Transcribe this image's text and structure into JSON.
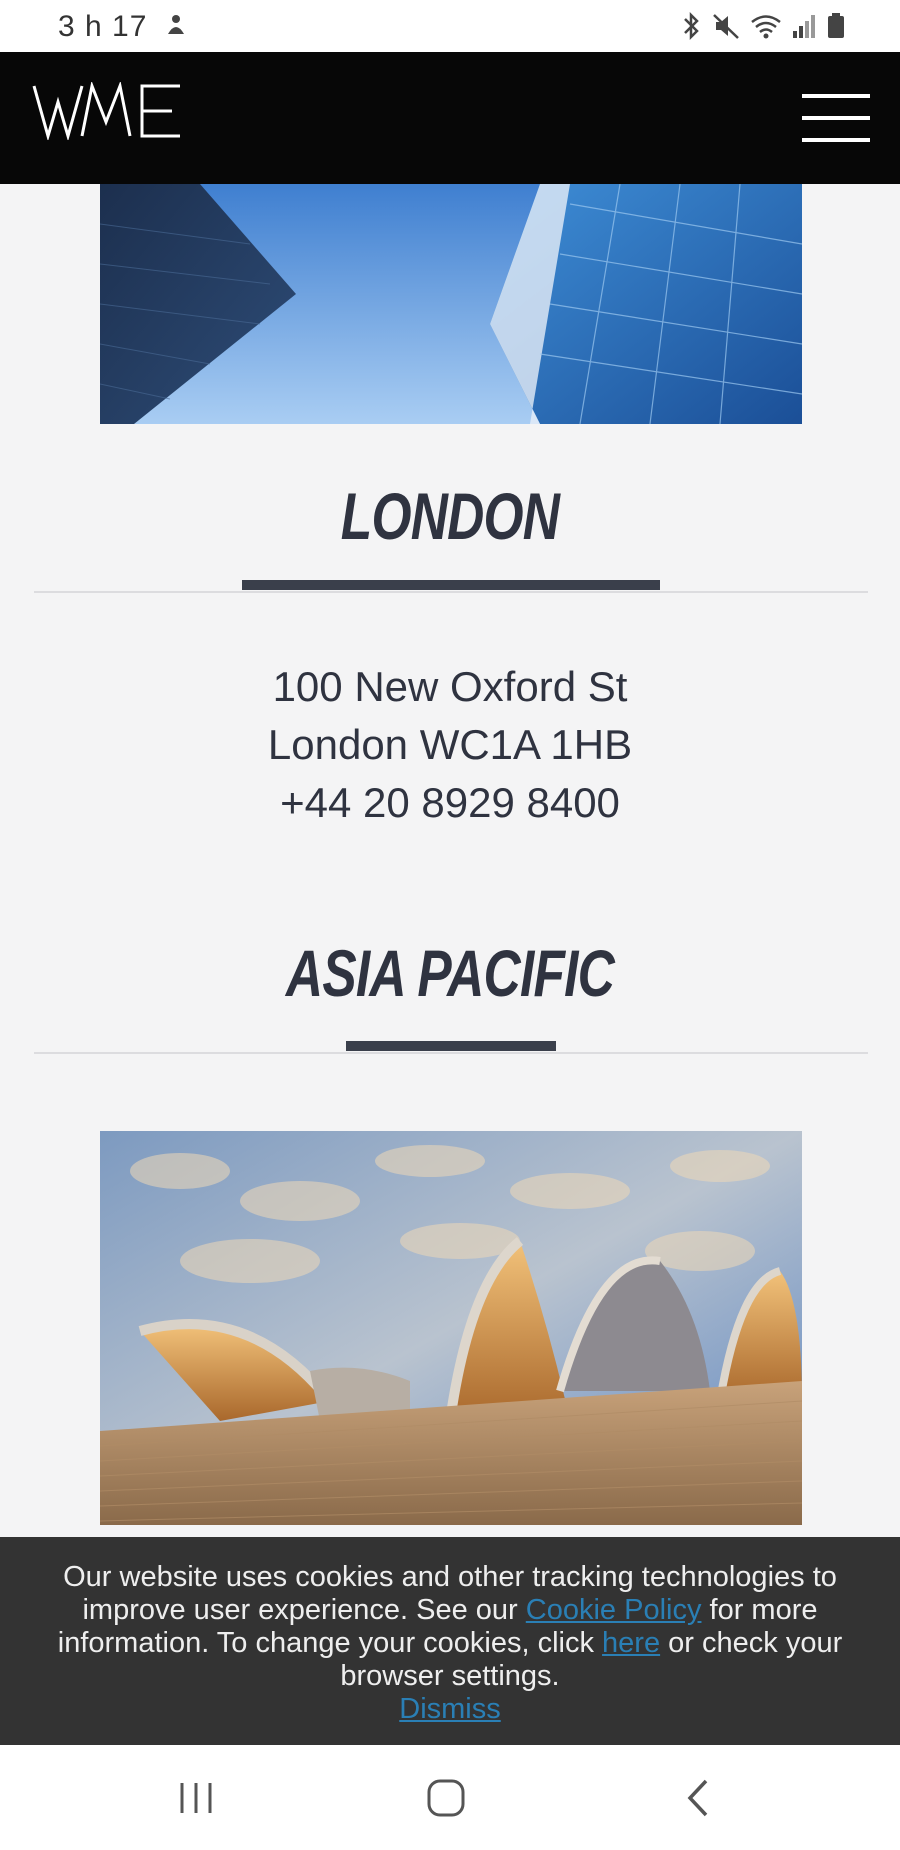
{
  "status_bar": {
    "time": "3 h 17",
    "left_icon": "notification-icon",
    "right_icons": [
      "bluetooth-icon",
      "mute-icon",
      "wifi-icon",
      "signal-icon",
      "battery-icon"
    ]
  },
  "header": {
    "logo_text": "WME",
    "menu_icon": "hamburger-menu-icon"
  },
  "sections": {
    "london": {
      "title": "LONDON",
      "address_line1": "100 New Oxford St",
      "address_line2": "London WC1A 1HB",
      "phone": "+44 20 8929 8400"
    },
    "asia_pacific": {
      "title": "ASIA PACIFIC"
    }
  },
  "cookie_banner": {
    "text_1": "Our website uses cookies and other tracking technologies to improve user experience. See our",
    "cookie_policy_link": "Cookie Policy",
    "text_2": "for more information. To change your cookies, click",
    "here_link": "here",
    "text_3": "or check your browser settings.",
    "dismiss_link": "Dismiss"
  },
  "nav_bar": {
    "items": [
      "recent-apps-icon",
      "home-icon",
      "back-icon"
    ]
  },
  "colors": {
    "header_bg": "#070707",
    "page_bg": "#f4f4f5",
    "title_color": "#2f3340",
    "cookie_bg": "#333333",
    "link_color": "#2a7fb5"
  }
}
